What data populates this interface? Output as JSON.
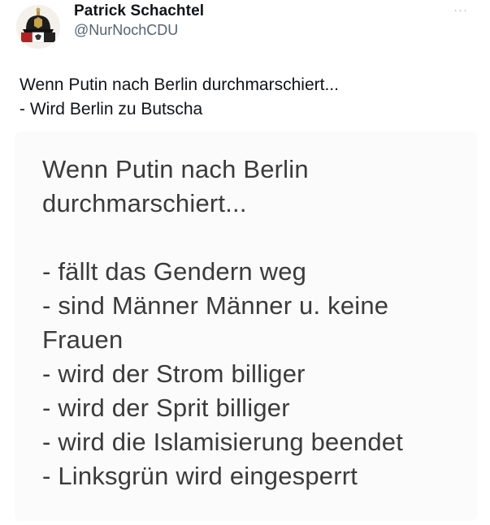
{
  "author": {
    "name": "Patrick Schachtel",
    "handle": "@NurNochCDU",
    "avatar_icon": "pickelhaube-avatar-icon"
  },
  "more_menu": {
    "label": "···",
    "icon": "more-options-icon"
  },
  "tweet": {
    "lines": [
      "Wenn Putin nach Berlin durchmarschiert...",
      "- Wird Berlin zu Butscha"
    ]
  },
  "media": {
    "heading_lines": [
      "Wenn Putin nach Berlin",
      "durchmarschiert..."
    ],
    "list_lines": [
      "- fällt das Gendern weg",
      "- sind Männer Männer u. keine",
      "Frauen",
      "- wird der Strom billiger",
      "- wird der Sprit billiger",
      "- wird die Islamisierung beendet",
      "- Linksgrün wird eingesperrt"
    ]
  },
  "colors": {
    "text": "#0f1419",
    "secondary": "#536471",
    "image_text": "#3b3b3b"
  }
}
